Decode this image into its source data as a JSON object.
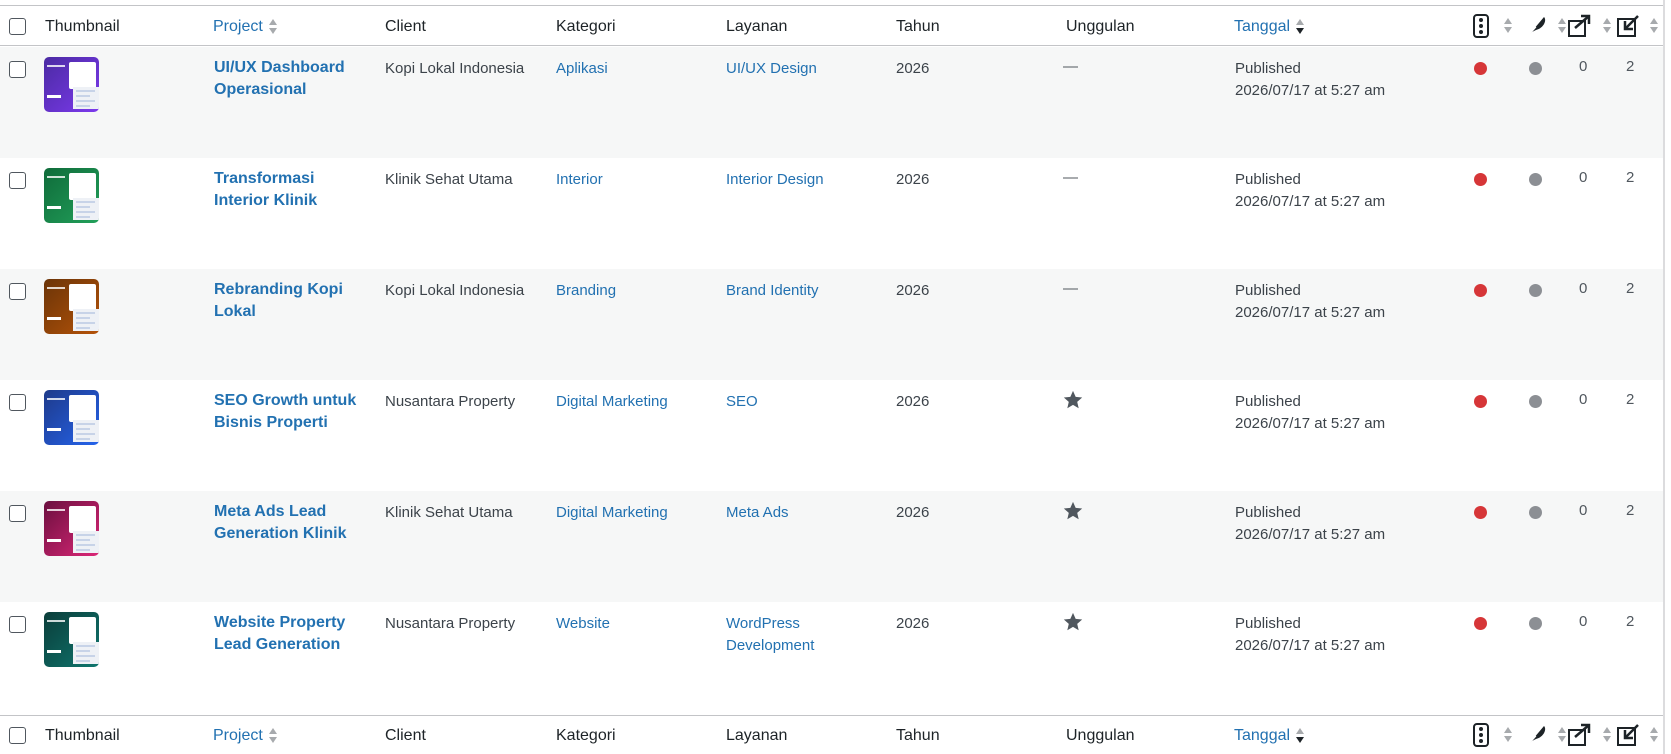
{
  "columns": {
    "thumbnail": "Thumbnail",
    "project": "Project",
    "client": "Client",
    "kategori": "Kategori",
    "layanan": "Layanan",
    "tahun": "Tahun",
    "unggulan": "Unggulan",
    "tanggal": "Tanggal"
  },
  "colors": {
    "link": "#2271b1",
    "alt_row": "#f6f7f7",
    "status_red": "#d63638",
    "status_grey": "#8c8f94"
  },
  "icons": [
    "seo-traffic-light-icon",
    "readability-feather-icon",
    "outgoing-links-icon",
    "incoming-links-icon",
    "star-icon"
  ],
  "rows": [
    {
      "title": "UI/UX Dashboard Operasional",
      "client": "Kopi Lokal Indonesia",
      "kategori": "Aplikasi",
      "layanan": "UI/UX Design",
      "tahun": "2026",
      "unggulan": "—",
      "featured": false,
      "status": "Published",
      "date": "2026/07/17 at 5:27 am",
      "outgoing": "0",
      "incoming": "2",
      "thumb_color": "#4b2aa3",
      "thumb_color2": "#7c3aed"
    },
    {
      "title": "Transformasi Interior Klinik",
      "client": "Klinik Sehat Utama",
      "kategori": "Interior",
      "layanan": "Interior Design",
      "tahun": "2026",
      "unggulan": "—",
      "featured": false,
      "status": "Published",
      "date": "2026/07/17 at 5:27 am",
      "outgoing": "0",
      "incoming": "2",
      "thumb_color": "#0f6b3a",
      "thumb_color2": "#22a05a"
    },
    {
      "title": "Rebranding Kopi Lokal",
      "client": "Kopi Lokal Indonesia",
      "kategori": "Branding",
      "layanan": "Brand Identity",
      "tahun": "2026",
      "unggulan": "—",
      "featured": false,
      "status": "Published",
      "date": "2026/07/17 at 5:27 am",
      "outgoing": "0",
      "incoming": "2",
      "thumb_color": "#6b3408",
      "thumb_color2": "#b45309"
    },
    {
      "title": "SEO Growth untuk Bisnis Properti",
      "client": "Nusantara Property",
      "kategori": "Digital Marketing",
      "layanan": "SEO",
      "tahun": "2026",
      "unggulan": "",
      "featured": true,
      "status": "Published",
      "date": "2026/07/17 at 5:27 am",
      "outgoing": "0",
      "incoming": "2",
      "thumb_color": "#1e3a8a",
      "thumb_color2": "#2563eb"
    },
    {
      "title": "Meta Ads Lead Generation Klinik",
      "client": "Klinik Sehat Utama",
      "kategori": "Digital Marketing",
      "layanan": "Meta Ads",
      "tahun": "2026",
      "unggulan": "",
      "featured": true,
      "status": "Published",
      "date": "2026/07/17 at 5:27 am",
      "outgoing": "0",
      "incoming": "2",
      "thumb_color": "#6b0f3f",
      "thumb_color2": "#db2777"
    },
    {
      "title": "Website Property Lead Generation",
      "client": "Nusantara Property",
      "kategori": "Website",
      "layanan": "WordPress Development",
      "tahun": "2026",
      "unggulan": "",
      "featured": true,
      "status": "Published",
      "date": "2026/07/17 at 5:27 am",
      "outgoing": "0",
      "incoming": "2",
      "thumb_color": "#0b3d3a",
      "thumb_color2": "#0f766e"
    }
  ]
}
